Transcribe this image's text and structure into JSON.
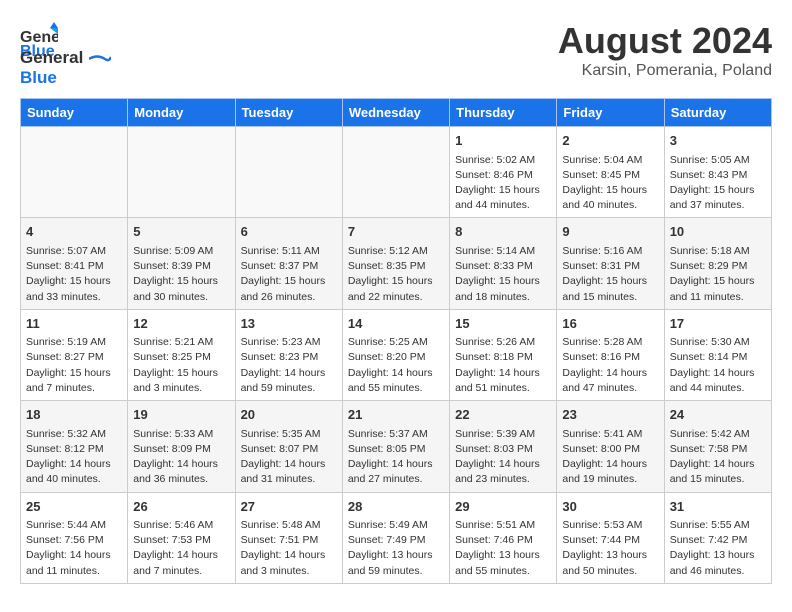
{
  "header": {
    "logo_line1": "General",
    "logo_line2": "Blue",
    "main_title": "August 2024",
    "subtitle": "Karsin, Pomerania, Poland"
  },
  "weekdays": [
    "Sunday",
    "Monday",
    "Tuesday",
    "Wednesday",
    "Thursday",
    "Friday",
    "Saturday"
  ],
  "weeks": [
    [
      {
        "day": "",
        "info": ""
      },
      {
        "day": "",
        "info": ""
      },
      {
        "day": "",
        "info": ""
      },
      {
        "day": "",
        "info": ""
      },
      {
        "day": "1",
        "info": "Sunrise: 5:02 AM\nSunset: 8:46 PM\nDaylight: 15 hours\nand 44 minutes."
      },
      {
        "day": "2",
        "info": "Sunrise: 5:04 AM\nSunset: 8:45 PM\nDaylight: 15 hours\nand 40 minutes."
      },
      {
        "day": "3",
        "info": "Sunrise: 5:05 AM\nSunset: 8:43 PM\nDaylight: 15 hours\nand 37 minutes."
      }
    ],
    [
      {
        "day": "4",
        "info": "Sunrise: 5:07 AM\nSunset: 8:41 PM\nDaylight: 15 hours\nand 33 minutes."
      },
      {
        "day": "5",
        "info": "Sunrise: 5:09 AM\nSunset: 8:39 PM\nDaylight: 15 hours\nand 30 minutes."
      },
      {
        "day": "6",
        "info": "Sunrise: 5:11 AM\nSunset: 8:37 PM\nDaylight: 15 hours\nand 26 minutes."
      },
      {
        "day": "7",
        "info": "Sunrise: 5:12 AM\nSunset: 8:35 PM\nDaylight: 15 hours\nand 22 minutes."
      },
      {
        "day": "8",
        "info": "Sunrise: 5:14 AM\nSunset: 8:33 PM\nDaylight: 15 hours\nand 18 minutes."
      },
      {
        "day": "9",
        "info": "Sunrise: 5:16 AM\nSunset: 8:31 PM\nDaylight: 15 hours\nand 15 minutes."
      },
      {
        "day": "10",
        "info": "Sunrise: 5:18 AM\nSunset: 8:29 PM\nDaylight: 15 hours\nand 11 minutes."
      }
    ],
    [
      {
        "day": "11",
        "info": "Sunrise: 5:19 AM\nSunset: 8:27 PM\nDaylight: 15 hours\nand 7 minutes."
      },
      {
        "day": "12",
        "info": "Sunrise: 5:21 AM\nSunset: 8:25 PM\nDaylight: 15 hours\nand 3 minutes."
      },
      {
        "day": "13",
        "info": "Sunrise: 5:23 AM\nSunset: 8:23 PM\nDaylight: 14 hours\nand 59 minutes."
      },
      {
        "day": "14",
        "info": "Sunrise: 5:25 AM\nSunset: 8:20 PM\nDaylight: 14 hours\nand 55 minutes."
      },
      {
        "day": "15",
        "info": "Sunrise: 5:26 AM\nSunset: 8:18 PM\nDaylight: 14 hours\nand 51 minutes."
      },
      {
        "day": "16",
        "info": "Sunrise: 5:28 AM\nSunset: 8:16 PM\nDaylight: 14 hours\nand 47 minutes."
      },
      {
        "day": "17",
        "info": "Sunrise: 5:30 AM\nSunset: 8:14 PM\nDaylight: 14 hours\nand 44 minutes."
      }
    ],
    [
      {
        "day": "18",
        "info": "Sunrise: 5:32 AM\nSunset: 8:12 PM\nDaylight: 14 hours\nand 40 minutes."
      },
      {
        "day": "19",
        "info": "Sunrise: 5:33 AM\nSunset: 8:09 PM\nDaylight: 14 hours\nand 36 minutes."
      },
      {
        "day": "20",
        "info": "Sunrise: 5:35 AM\nSunset: 8:07 PM\nDaylight: 14 hours\nand 31 minutes."
      },
      {
        "day": "21",
        "info": "Sunrise: 5:37 AM\nSunset: 8:05 PM\nDaylight: 14 hours\nand 27 minutes."
      },
      {
        "day": "22",
        "info": "Sunrise: 5:39 AM\nSunset: 8:03 PM\nDaylight: 14 hours\nand 23 minutes."
      },
      {
        "day": "23",
        "info": "Sunrise: 5:41 AM\nSunset: 8:00 PM\nDaylight: 14 hours\nand 19 minutes."
      },
      {
        "day": "24",
        "info": "Sunrise: 5:42 AM\nSunset: 7:58 PM\nDaylight: 14 hours\nand 15 minutes."
      }
    ],
    [
      {
        "day": "25",
        "info": "Sunrise: 5:44 AM\nSunset: 7:56 PM\nDaylight: 14 hours\nand 11 minutes."
      },
      {
        "day": "26",
        "info": "Sunrise: 5:46 AM\nSunset: 7:53 PM\nDaylight: 14 hours\nand 7 minutes."
      },
      {
        "day": "27",
        "info": "Sunrise: 5:48 AM\nSunset: 7:51 PM\nDaylight: 14 hours\nand 3 minutes."
      },
      {
        "day": "28",
        "info": "Sunrise: 5:49 AM\nSunset: 7:49 PM\nDaylight: 13 hours\nand 59 minutes."
      },
      {
        "day": "29",
        "info": "Sunrise: 5:51 AM\nSunset: 7:46 PM\nDaylight: 13 hours\nand 55 minutes."
      },
      {
        "day": "30",
        "info": "Sunrise: 5:53 AM\nSunset: 7:44 PM\nDaylight: 13 hours\nand 50 minutes."
      },
      {
        "day": "31",
        "info": "Sunrise: 5:55 AM\nSunset: 7:42 PM\nDaylight: 13 hours\nand 46 minutes."
      }
    ]
  ]
}
